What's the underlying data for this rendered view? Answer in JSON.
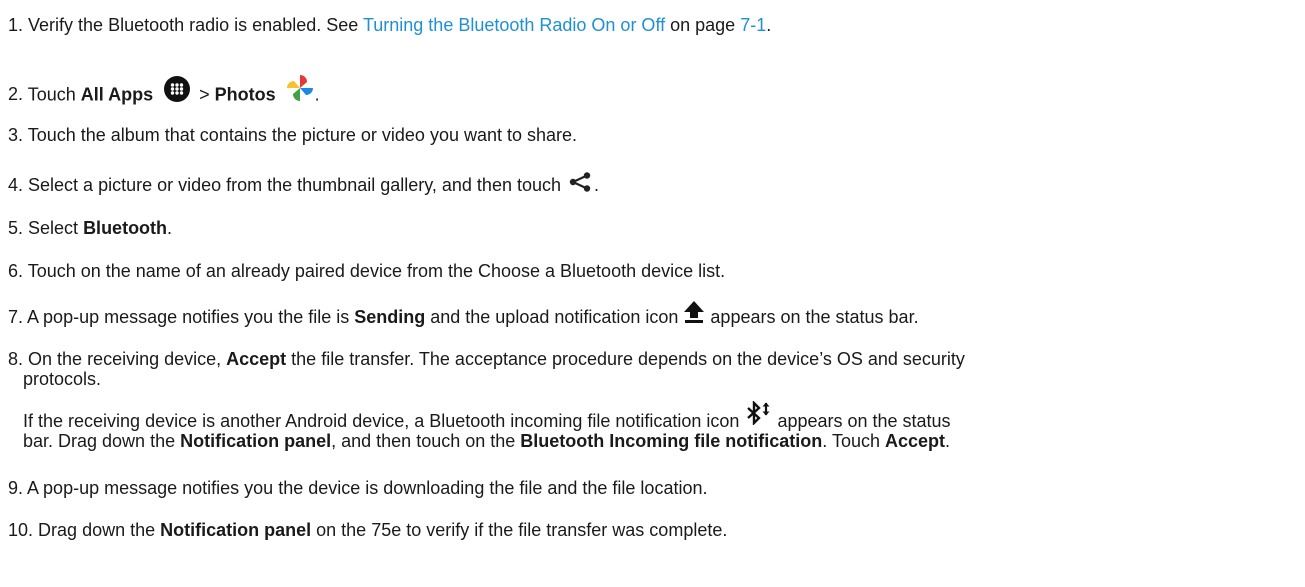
{
  "steps": [
    {
      "num": "1.",
      "pre": "Verify the Bluetooth radio is enabled. See ",
      "link": "Turning the Bluetooth Radio On or Off",
      "mid": " on page ",
      "page_link": "7-1",
      "post": "."
    },
    {
      "num": "2.",
      "pre": "Touch ",
      "b1": "All Apps",
      "gt": " > ",
      "b2": "Photos",
      "post": ".",
      "icons": [
        "all-apps-icon",
        "photos-icon"
      ]
    },
    {
      "num": "3.",
      "text": "Touch the album that contains the picture or video you want to share."
    },
    {
      "num": "4.",
      "pre": "Select a picture or video from the thumbnail gallery, and then touch ",
      "post": ".",
      "icons": [
        "share-icon"
      ]
    },
    {
      "num": "5.",
      "pre": "Select ",
      "b1": "Bluetooth",
      "post": "."
    },
    {
      "num": "6.",
      "text": "Touch on the name of an already paired device from the Choose a Bluetooth device list."
    },
    {
      "num": "7.",
      "pre": "A pop-up message notifies you the file is ",
      "b1": "Sending",
      "mid": " and the upload notification icon ",
      "post": " appears on the status bar.",
      "icons": [
        "upload-icon"
      ]
    },
    {
      "num": "8.",
      "pre": "On the receiving device, ",
      "b1": "Accept",
      "post_line1": " the file transfer. The acceptance procedure depends on the device’s OS and security",
      "line2": "protocols."
    },
    {
      "note": {
        "line1_pre": "If the receiving device is another Android device, a Bluetooth incoming file notification icon ",
        "line1_post": " appears on the status",
        "line2_pre": "bar. Drag down the ",
        "line2_b1": "Notification panel",
        "line2_mid": ", and then touch on the ",
        "line2_b2": "Bluetooth Incoming file notification",
        "line2_mid2": ". Touch ",
        "line2_b3": "Accept",
        "line2_post": ".",
        "icons": [
          "bluetooth-transfer-icon"
        ]
      }
    },
    {
      "num": "9.",
      "text": "A pop-up message notifies you the device is downloading the file and the file location."
    },
    {
      "num": "10.",
      "pre": "Drag down the ",
      "b1": "Notification panel",
      "post": " on the 75e to verify if the file transfer was complete."
    }
  ],
  "colors": {
    "link": "#1f8fd6",
    "text": "#1a1a1a"
  }
}
